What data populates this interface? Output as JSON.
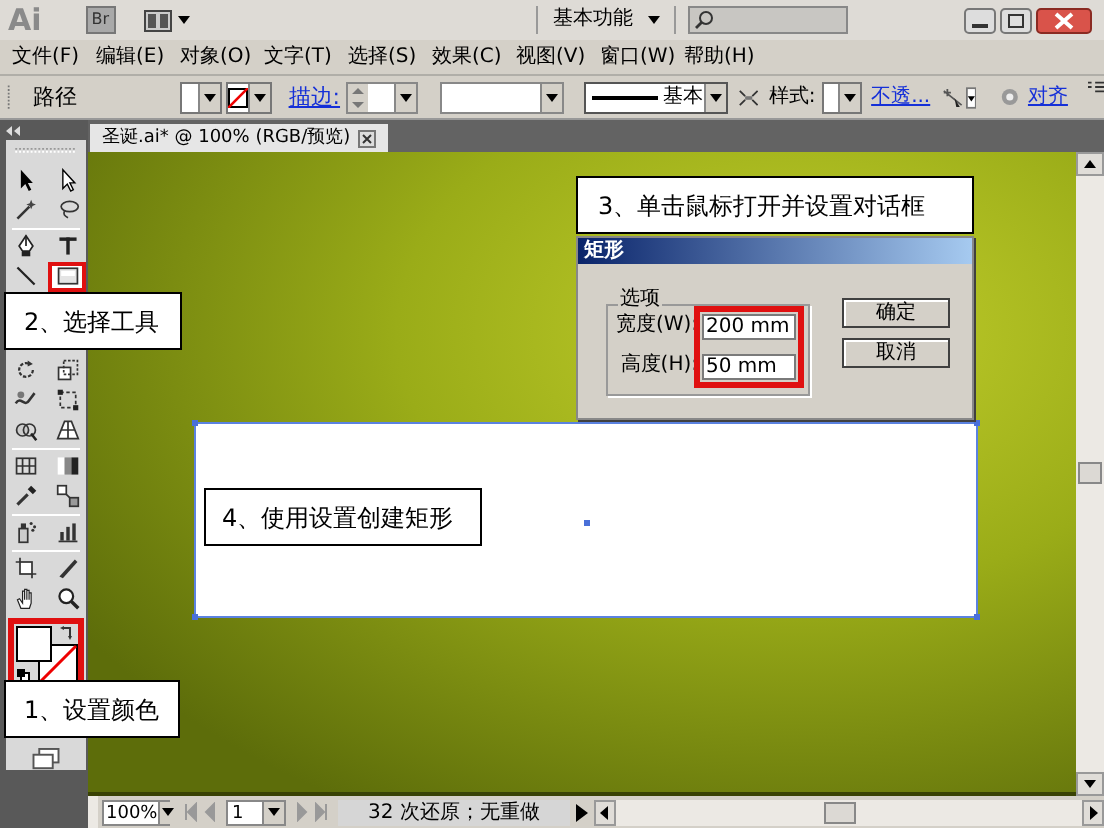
{
  "app_bar": {
    "logo": "Ai",
    "bridge": "Br",
    "workspace": "基本功能"
  },
  "menu": [
    "文件(F)",
    "编辑(E)",
    "对象(O)",
    "文字(T)",
    "选择(S)",
    "效果(C)",
    "视图(V)",
    "窗口(W)",
    "帮助(H)"
  ],
  "control_bar": {
    "label": "路径",
    "stroke_none": true,
    "stroke_link": "描边:",
    "stroke_profile": "基本",
    "style_label": "样式:",
    "opacity_link": "不透...",
    "align_link": "对齐"
  },
  "document_tab": {
    "title": "圣诞.ai* @ 100% (RGB/预览)"
  },
  "tool_groups": [
    [
      {
        "kind": "selection",
        "selected": false,
        "highlighted": false
      },
      {
        "kind": "direct-selection",
        "selected": false,
        "highlighted": false
      },
      {
        "kind": "magic-wand",
        "selected": false,
        "highlighted": false
      },
      {
        "kind": "lasso",
        "selected": false,
        "highlighted": false
      }
    ],
    [
      {
        "kind": "pen",
        "selected": false,
        "highlighted": false
      },
      {
        "kind": "type",
        "selected": false,
        "highlighted": false
      },
      {
        "kind": "line",
        "selected": false,
        "highlighted": false
      },
      {
        "kind": "rectangle",
        "selected": true,
        "highlighted": true
      }
    ],
    [
      {
        "kind": "rotate",
        "selected": false,
        "highlighted": false
      },
      {
        "kind": "scale",
        "selected": false,
        "highlighted": false
      },
      {
        "kind": "warp",
        "selected": false,
        "highlighted": false
      },
      {
        "kind": "free-transform",
        "selected": false,
        "highlighted": false
      },
      {
        "kind": "shape-builder",
        "selected": false,
        "highlighted": false
      },
      {
        "kind": "perspective",
        "selected": false,
        "highlighted": false
      }
    ],
    [
      {
        "kind": "mesh",
        "selected": false,
        "highlighted": false
      },
      {
        "kind": "gradient",
        "selected": false,
        "highlighted": false
      },
      {
        "kind": "eyedropper",
        "selected": false,
        "highlighted": false
      },
      {
        "kind": "blend",
        "selected": false,
        "highlighted": false
      }
    ],
    [
      {
        "kind": "symbol-sprayer",
        "selected": false,
        "highlighted": false
      },
      {
        "kind": "graph",
        "selected": false,
        "highlighted": false
      }
    ],
    [
      {
        "kind": "artboard",
        "selected": false,
        "highlighted": false
      },
      {
        "kind": "slice",
        "selected": false,
        "highlighted": false
      },
      {
        "kind": "hand",
        "selected": false,
        "highlighted": false
      },
      {
        "kind": "zoom",
        "selected": false,
        "highlighted": false
      }
    ]
  ],
  "fill_stroke": {
    "stroke_none": true,
    "highlighted": true
  },
  "dialog": {
    "title": "矩形",
    "group": "选项",
    "fields_highlighted": true,
    "fields": [
      {
        "label": "宽度(W):",
        "value": "200 mm"
      },
      {
        "label": "高度(H):",
        "value": "50 mm"
      }
    ],
    "buttons": [
      "确定",
      "取消"
    ]
  },
  "callouts": [
    {
      "text": "3、单击鼠标打开并设置对话框"
    },
    {
      "text": "2、选择工具"
    },
    {
      "text": "4、使用设置创建矩形"
    },
    {
      "text": "1、设置颜色"
    }
  ],
  "status_bar": {
    "zoom": "100%",
    "page": "1",
    "info": "32 次还原；无重做"
  }
}
